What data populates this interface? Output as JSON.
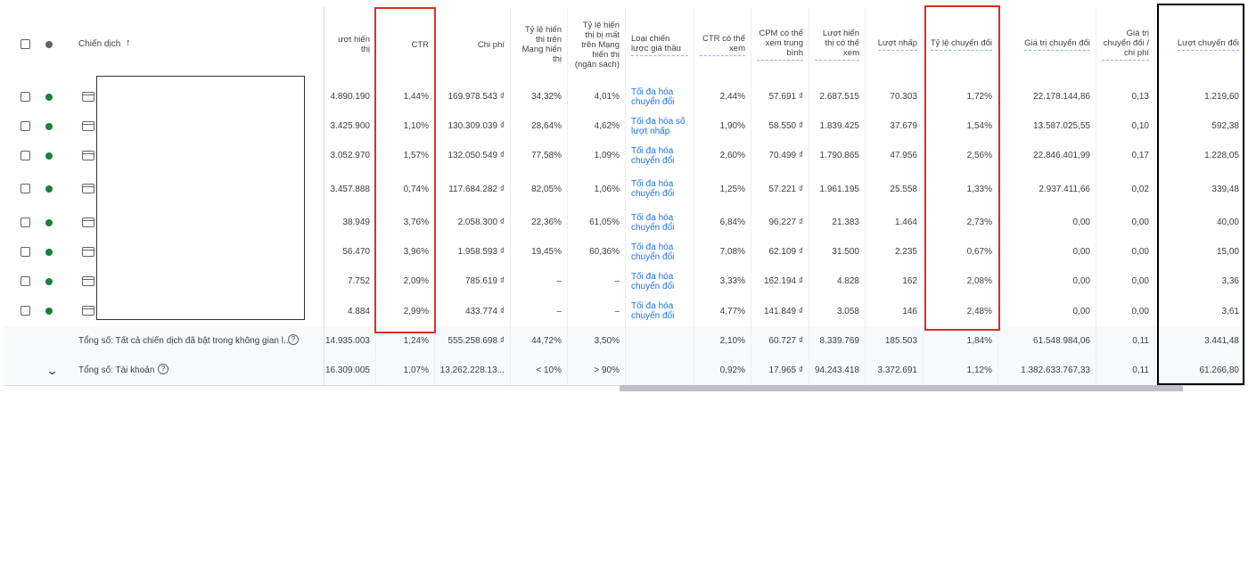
{
  "header": {
    "campaign": "Chiến dịch",
    "sort_icon": "arrow-up-icon",
    "columns": [
      "ượt hiển thị",
      "CTR",
      "Chi phí",
      "Tỷ lệ hiển thị trên Mạng hiển thị",
      "Tỷ lệ hiển thị bị mất trên Mạng hiển thị (ngân sách)",
      "Loại chiến lược giá thầu",
      "CTR có thể xem",
      "CPM có thể xem trung bình",
      "Lượt hiển thị có thể xem",
      "Lượt nhấp",
      "Tỷ lệ chuyển đổi",
      "Giá trị chuyển đổi",
      "Giá trị chuyển đổi / chi phí",
      "Lượt chuyển đổi"
    ]
  },
  "rows": [
    [
      "4.890.190",
      "1,44%",
      "169.978.543 ₫",
      "34,32%",
      "4,01%",
      "Tối đa hóa chuyển đổi",
      "2,44%",
      "57.691 ₫",
      "2.687.515",
      "70.303",
      "1,72%",
      "22.178.144,86",
      "0,13",
      "1.219,60"
    ],
    [
      "3.425.900",
      "1,10%",
      "130.309.039 ₫",
      "28,64%",
      "4,62%",
      "Tối đa hóa số lượt nhấp",
      "1,90%",
      "58.550 ₫",
      "1.839.425",
      "37.679",
      "1,54%",
      "13.587.025,55",
      "0,10",
      "592,38"
    ],
    [
      "3.052.970",
      "1,57%",
      "132.050.549 ₫",
      "77,58%",
      "1,09%",
      "Tối đa hóa chuyển đổi",
      "2,60%",
      "70.499 ₫",
      "1.790.865",
      "47.956",
      "2,56%",
      "22.846.401,99",
      "0,17",
      "1.228,05"
    ],
    [
      "3.457.888",
      "0,74%",
      "117.684.282 ₫",
      "82,05%",
      "1,06%",
      "Tối đa hóa chuyển đổi",
      "1,25%",
      "57.221 ₫",
      "1.961.195",
      "25.558",
      "1,33%",
      "2.937.411,66",
      "0,02",
      "339,48"
    ],
    [
      "38.949",
      "3,76%",
      "2.058.300 ₫",
      "22,36%",
      "61,05%",
      "Tối đa hóa chuyển đổi",
      "6,84%",
      "96.227 ₫",
      "21.383",
      "1.464",
      "2,73%",
      "0,00",
      "0,00",
      "40,00"
    ],
    [
      "56.470",
      "3,96%",
      "1.958.593 ₫",
      "19,45%",
      "60,36%",
      "Tối đa hóa chuyển đổi",
      "7,08%",
      "62.109 ₫",
      "31.500",
      "2.235",
      "0,67%",
      "0,00",
      "0,00",
      "15,00"
    ],
    [
      "7.752",
      "2,09%",
      "785.619 ₫",
      "–",
      "–",
      "Tối đa hóa chuyển đổi",
      "3,33%",
      "162.194 ₫",
      "4.828",
      "162",
      "2,08%",
      "0,00",
      "0,00",
      "3,36"
    ],
    [
      "4.884",
      "2,99%",
      "433.774 ₫",
      "–",
      "–",
      "Tối đa hóa chuyển đổi",
      "4,77%",
      "141.849 ₫",
      "3.058",
      "146",
      "2,48%",
      "0,00",
      "0,00",
      "3,61"
    ]
  ],
  "totals": [
    {
      "label": "Tổng số: Tất cả chiến dịch đã bật trong không gian l...",
      "values": [
        "14.935.003",
        "1,24%",
        "555.258.698 ₫",
        "44,72%",
        "3,50%",
        "",
        "2,10%",
        "60.727 ₫",
        "8.339.769",
        "185.503",
        "1,84%",
        "61.548.984,06",
        "0,11",
        "3.441,48"
      ]
    },
    {
      "label": "Tổng số: Tài khoản",
      "values": [
        "16.309.005",
        "1,07%",
        "13.262.228.13...",
        "< 10%",
        "> 90%",
        "",
        "0,92%",
        "17.965 ₫",
        "94.243.418",
        "3.372.691",
        "1,12%",
        "1.382.633.767,33",
        "0,11",
        "61.266,80"
      ]
    }
  ],
  "colors": {
    "highlight_red": "#d93025",
    "highlight_black": "#000000",
    "status_green": "#188038",
    "link": "#1a73e8"
  }
}
